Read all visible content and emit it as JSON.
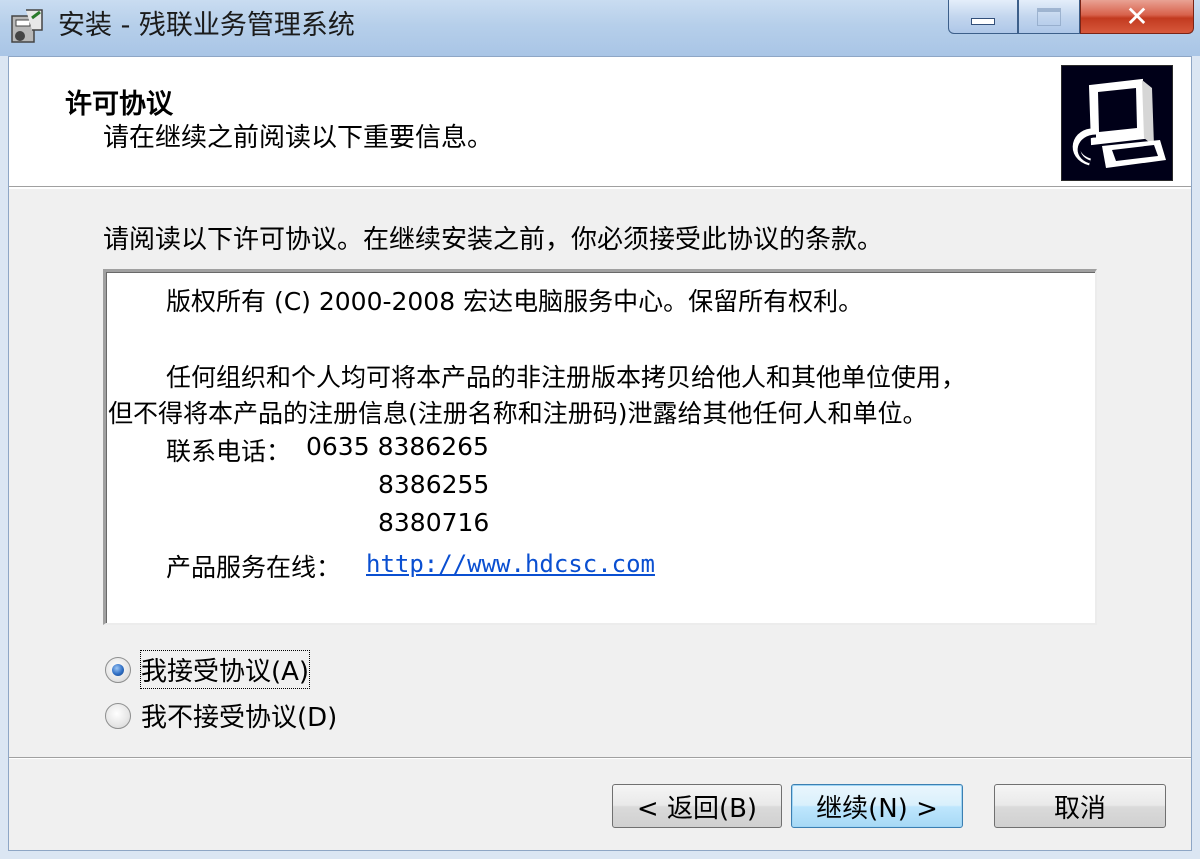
{
  "window": {
    "title": "安装 - 残联业务管理系统",
    "close_glyph": "✕"
  },
  "header": {
    "title": "许可协议",
    "subtitle": "请在继续之前阅读以下重要信息。"
  },
  "intro": "请阅读以下许可协议。在继续安装之前，你必须接受此协议的条款。",
  "license": {
    "copyright": "版权所有 (C) 2000-2008 宏达电脑服务中心。保留所有权利。",
    "para1_line1": "任何组织和个人均可将本产品的非注册版本拷贝给他人和其他单位使用，",
    "para1_line2": "但不得将本产品的注册信息(注册名称和注册码)泄露给其他任何人和单位。",
    "phone_label": "联系电话：",
    "phones": [
      "0635 8386265",
      "8386255",
      "8380716"
    ],
    "online_label": "产品服务在线：",
    "url": "http://www.hdcsc.com"
  },
  "radios": [
    {
      "label": "我接受协议(A)",
      "checked": true
    },
    {
      "label": "我不接受协议(D)",
      "checked": false
    }
  ],
  "buttons": {
    "back": "< 返回(B)",
    "next": "继续(N) >",
    "cancel": "取消"
  },
  "colors": {
    "accent": "#3c7fb1",
    "link": "#0a4fd1",
    "close": "#c23a1f"
  }
}
